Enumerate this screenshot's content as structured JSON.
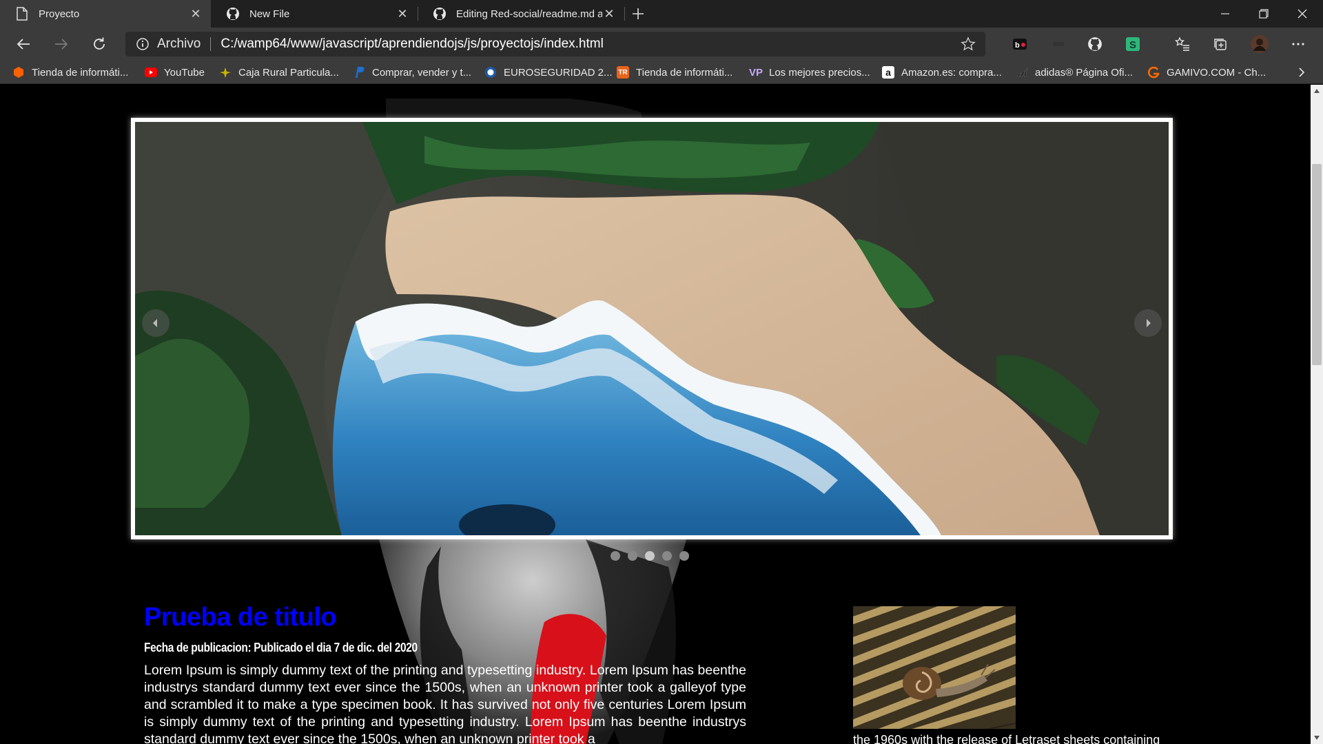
{
  "browser": {
    "tabs": [
      {
        "title": "Proyecto",
        "active": true,
        "icon": "page-icon"
      },
      {
        "title": "New File",
        "active": false,
        "icon": "github-icon"
      },
      {
        "title": "Editing Red-social/readme.md at",
        "active": false,
        "icon": "github-icon"
      }
    ],
    "address": {
      "scheme_label": "Archivo",
      "url": "C:/wamp64/www/javascript/aprendiendojs/js/proyectojs/index.html"
    },
    "favorites": [
      {
        "label": "Tienda de informáti...",
        "icon": "pccomponentes-icon",
        "color": "#ff6000"
      },
      {
        "label": "YouTube",
        "icon": "youtube-icon",
        "color": "#ff0000"
      },
      {
        "label": "Caja Rural Particula...",
        "icon": "caja-rural-icon",
        "color": "#c9b200"
      },
      {
        "label": "Comprar, vender y t...",
        "icon": "paypal-icon",
        "color": "#003087"
      },
      {
        "label": "EUROSEGURIDAD 2...",
        "icon": "euroseguridad-icon",
        "color": "#1e5aa8"
      },
      {
        "label": "Tienda de informáti...",
        "icon": "tr-icon",
        "color": "#e8641b"
      },
      {
        "label": "Los mejores precios...",
        "icon": "vp-icon",
        "color": "#6a3fb5"
      },
      {
        "label": "Amazon.es: compra...",
        "icon": "amazon-icon",
        "color": "#ffffff"
      },
      {
        "label": "adidas® Página Ofi...",
        "icon": "adidas-icon",
        "color": "#111111"
      },
      {
        "label": "GAMIVO.COM - Ch...",
        "icon": "gamivo-icon",
        "color": "#ff6a00"
      }
    ]
  },
  "page": {
    "carousel": {
      "slide_count": 5,
      "active_slide": 3
    },
    "article": {
      "title": "Prueba de titulo",
      "date": "Fecha de publicacion: Publicado el dia 7 de dic. del 2020",
      "body": "Lorem Ipsum is simply dummy text of the printing and typesetting industry. Lorem Ipsum has beenthe industrys standard dummy text ever since the 1500s, when an unknown printer took a galleyof type and scrambled it to make a type specimen book. It has survived not only five centuries Lorem Ipsum is simply dummy text of the printing and typesetting industry. Lorem Ipsum has beenthe industrys standard dummy text ever since the 1500s, when an unknown printer took a"
    },
    "aside": {
      "caption": "the 1960s with the release of Letraset sheets containing"
    }
  },
  "colors": {
    "title_blue": "#0000ff",
    "page_background": "#000000",
    "browser_chrome": "#3b3b3b"
  }
}
